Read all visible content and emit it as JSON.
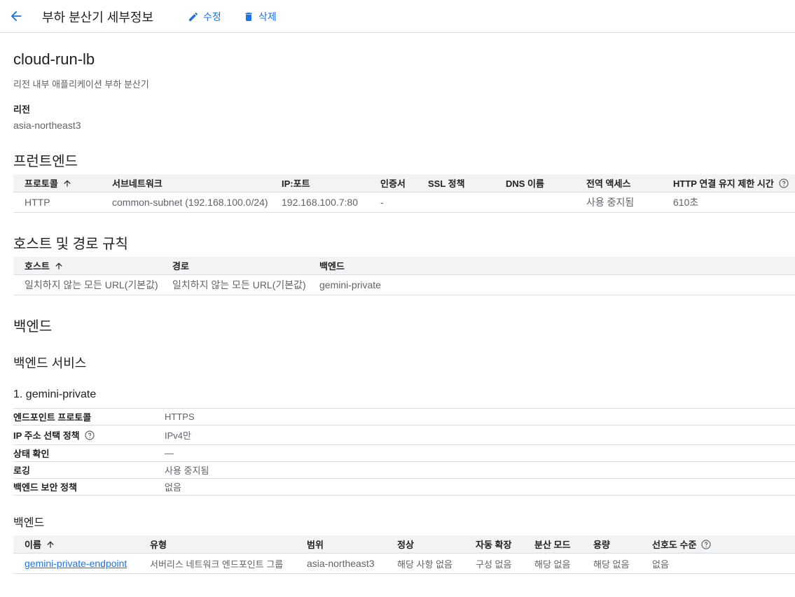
{
  "header": {
    "title": "부하 분산기 세부정보",
    "edit_label": "수정",
    "delete_label": "삭제"
  },
  "lb": {
    "name": "cloud-run-lb",
    "type": "리전 내부 애플리케이션 부하 분산기",
    "region_label": "리전",
    "region_value": "asia-northeast3"
  },
  "frontend": {
    "title": "프런트엔드",
    "columns": [
      "프로토콜",
      "서브네트워크",
      "IP:포트",
      "인증서",
      "SSL 정책",
      "DNS 이름",
      "전역 액세스",
      "HTTP 연결 유지 제한 시간"
    ],
    "rows": [
      [
        "HTTP",
        "common-subnet (192.168.100.0/24)",
        "192.168.100.7:80",
        "-",
        "",
        "",
        "사용 중지됨",
        "610초"
      ]
    ]
  },
  "routing": {
    "title": "호스트 및 경로 규칙",
    "columns": [
      "호스트",
      "경로",
      "백엔드"
    ],
    "rows": [
      [
        "일치하지 않는 모든 URL(기본값)",
        "일치하지 않는 모든 URL(기본값)",
        "gemini-private"
      ]
    ]
  },
  "backend": {
    "title": "백엔드",
    "services_title": "백엔드 서비스",
    "service_name": "1. gemini-private",
    "details": [
      {
        "label": "엔드포인트 프로토콜",
        "value": "HTTPS"
      },
      {
        "label": "IP 주소 선택 정책",
        "value": "IPv4만"
      },
      {
        "label": "상태 확인",
        "value": "—"
      },
      {
        "label": "로깅",
        "value": "사용 중지됨"
      },
      {
        "label": "백엔드 보안 정책",
        "value": "없음"
      }
    ],
    "backends_title": "백엔드",
    "columns": [
      "이름",
      "유형",
      "범위",
      "정상",
      "자동 확장",
      "분산 모드",
      "용량",
      "선호도 수준"
    ],
    "rows": [
      [
        "gemini-private-endpoint",
        "서버리스 네트워크 엔드포인트 그룹",
        "asia-northeast3",
        "해당 사항 없음",
        "구성 없음",
        "해당 없음",
        "해당 없음",
        "없음"
      ]
    ]
  },
  "colors": {
    "accent": "#1a73e8",
    "header_bg": "#f1f3f4",
    "divider": "#dadce0"
  },
  "icons": [
    "arrow-left-icon",
    "pencil-icon",
    "trash-icon",
    "arrow-up-icon",
    "help-circle-icon"
  ]
}
